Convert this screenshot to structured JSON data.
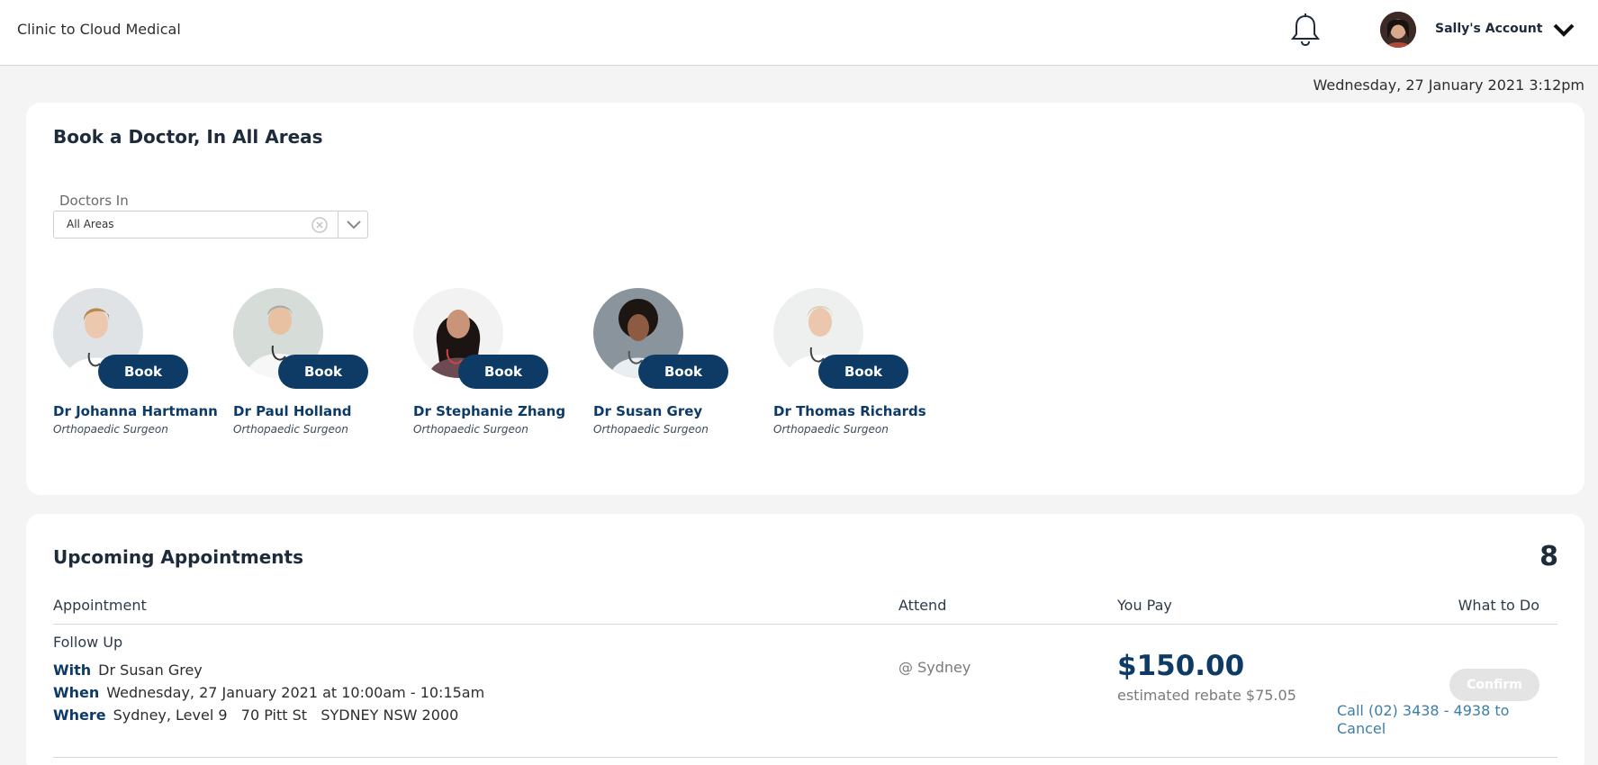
{
  "header": {
    "brand": "Clinic to Cloud Medical",
    "account_label": "Sally's Account",
    "icons": {
      "notifications": "bell-icon",
      "account_menu": "chevron-down-icon"
    }
  },
  "datetime": "Wednesday, 27 January 2021 3:12pm",
  "booking": {
    "title": "Book a Doctor, In All Areas",
    "filter_label": "Doctors In",
    "filter_value": "All Areas",
    "book_label": "Book",
    "doctors": [
      {
        "name": "Dr Johanna Hartmann",
        "specialty": "Orthopaedic Surgeon"
      },
      {
        "name": "Dr Paul Holland",
        "specialty": "Orthopaedic Surgeon"
      },
      {
        "name": "Dr Stephanie Zhang",
        "specialty": "Orthopaedic Surgeon"
      },
      {
        "name": "Dr Susan Grey",
        "specialty": "Orthopaedic Surgeon"
      },
      {
        "name": "Dr Thomas Richards",
        "specialty": "Orthopaedic Surgeon"
      }
    ]
  },
  "appointments": {
    "title": "Upcoming Appointments",
    "count": "8",
    "columns": [
      "Appointment",
      "Attend",
      "You Pay",
      "What to Do"
    ],
    "rows": [
      {
        "type": "Follow Up",
        "with_label": "With",
        "with": "Dr Susan Grey",
        "when_label": "When",
        "when": "Wednesday, 27 January 2021 at 10:00am - 10:15am",
        "where_label": "Where",
        "where": "Sydney, Level 9   70 Pitt St   SYDNEY NSW 2000",
        "attend": "@ Sydney",
        "price": "$150.00",
        "rebate": "estimated rebate $75.05",
        "confirm_label": "Confirm",
        "cancel_text": "Call (02) 3438 - 4938 to Cancel"
      }
    ]
  },
  "colors": {
    "primary": "#0d3b66",
    "link": "#3d7ea6",
    "background": "#f4f4f4",
    "disabled": "#e4e4e4"
  }
}
